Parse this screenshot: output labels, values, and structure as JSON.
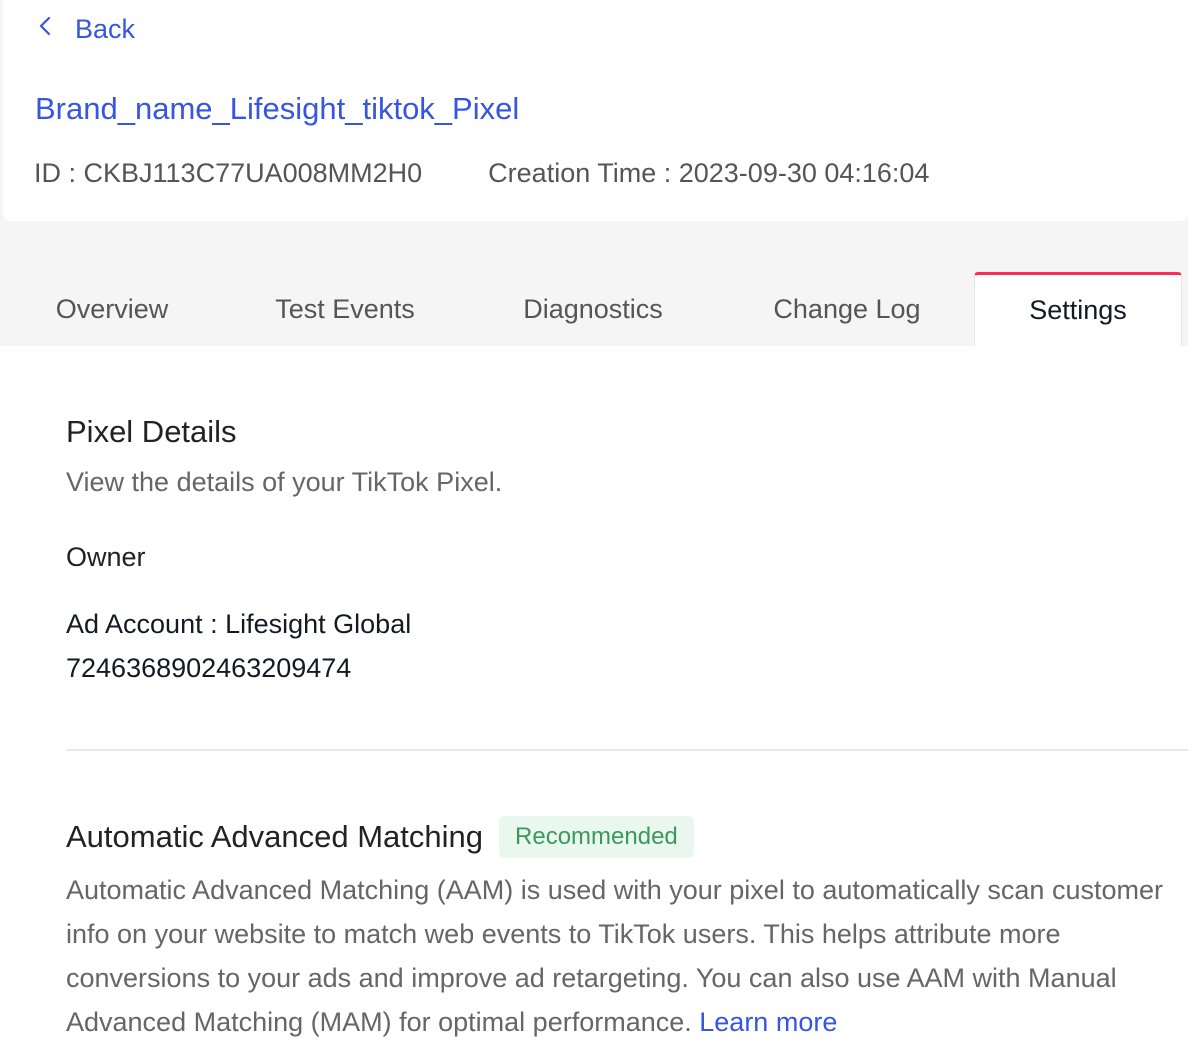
{
  "header": {
    "back_label": "Back",
    "pixel_name": "Brand_name_Lifesight_tiktok_Pixel",
    "id_text": "ID : CKBJ113C77UA008MM2H0",
    "creation_text": "Creation Time : 2023-09-30 04:16:04"
  },
  "tabs": [
    {
      "label": "Overview"
    },
    {
      "label": "Test Events"
    },
    {
      "label": "Diagnostics"
    },
    {
      "label": "Change Log"
    },
    {
      "label": "Settings",
      "active": true
    }
  ],
  "pixel_details": {
    "title": "Pixel Details",
    "description": "View the details of your TikTok Pixel.",
    "owner_label": "Owner",
    "ad_account_line": "Ad Account : Lifesight Global",
    "ad_account_id": "7246368902463209474"
  },
  "aam": {
    "title": "Automatic Advanced Matching",
    "badge": "Recommended",
    "description": "Automatic Advanced Matching (AAM) is used with your pixel to automatically scan customer info on your website to match web events to TikTok users. This helps attribute more conversions to your ads and improve ad retargeting. You can also use AAM with Manual Advanced Matching (MAM) for optimal performance.",
    "learn_more": "Learn more"
  },
  "colors": {
    "link": "#3656e0",
    "active_tab_accent": "#fe2c55",
    "badge_bg": "#eaf7ee",
    "badge_text": "#3a9a5b"
  },
  "icons": {
    "back": "chevron-left-icon"
  }
}
